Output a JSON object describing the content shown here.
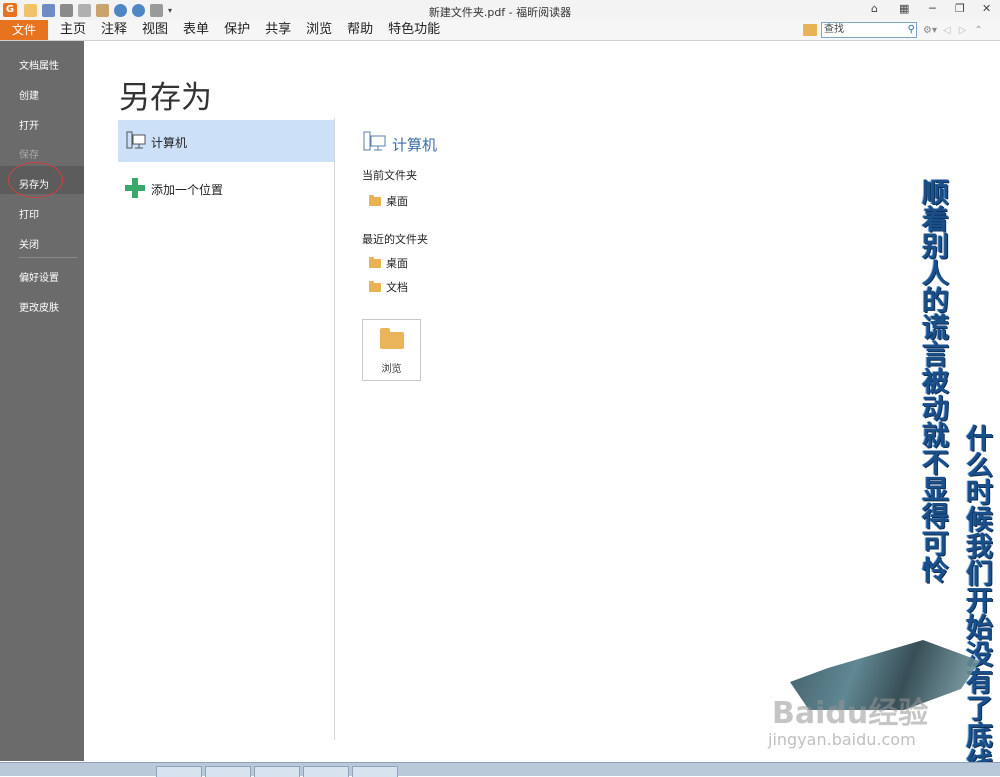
{
  "window": {
    "title": "新建文件夹.pdf - 福昕阅读器",
    "app_logo_letter": "G"
  },
  "menubar": {
    "file": "文件",
    "items": [
      "主页",
      "注释",
      "视图",
      "表单",
      "保护",
      "共享",
      "浏览",
      "帮助",
      "特色功能"
    ],
    "search_placeholder": "查找"
  },
  "sidebar": {
    "items": [
      {
        "label": "文档属性"
      },
      {
        "label": "创建"
      },
      {
        "label": "打开"
      },
      {
        "label": "保存",
        "disabled": true
      },
      {
        "label": "另存为",
        "active": true
      },
      {
        "label": "打印"
      },
      {
        "label": "关闭"
      },
      {
        "label": "偏好设置"
      },
      {
        "label": "更改皮肤"
      }
    ]
  },
  "main": {
    "title": "另存为",
    "locations": [
      {
        "label": "计算机",
        "icon": "computer-icon",
        "selected": true
      },
      {
        "label": "添加一个位置",
        "icon": "plus-icon"
      }
    ],
    "detail": {
      "heading": "计算机",
      "current_folder_label": "当前文件夹",
      "current_folders": [
        "桌面"
      ],
      "recent_folder_label": "最近的文件夹",
      "recent_folders": [
        "桌面",
        "文档"
      ],
      "browse_label": "浏览"
    }
  },
  "overlay": {
    "vertical_text_1": "顺着别人的谎言被动就不显得可怜",
    "vertical_text_2": "什么时候我们开始没有了底线",
    "watermark_1": "Baidu经验",
    "watermark_2": "jingyan.baidu.com"
  },
  "colors": {
    "accent": "#e8731f",
    "sidebar_bg": "#6b6b6b",
    "selected_bg": "#cce0f8",
    "heading_blue": "#3b6ea8"
  }
}
